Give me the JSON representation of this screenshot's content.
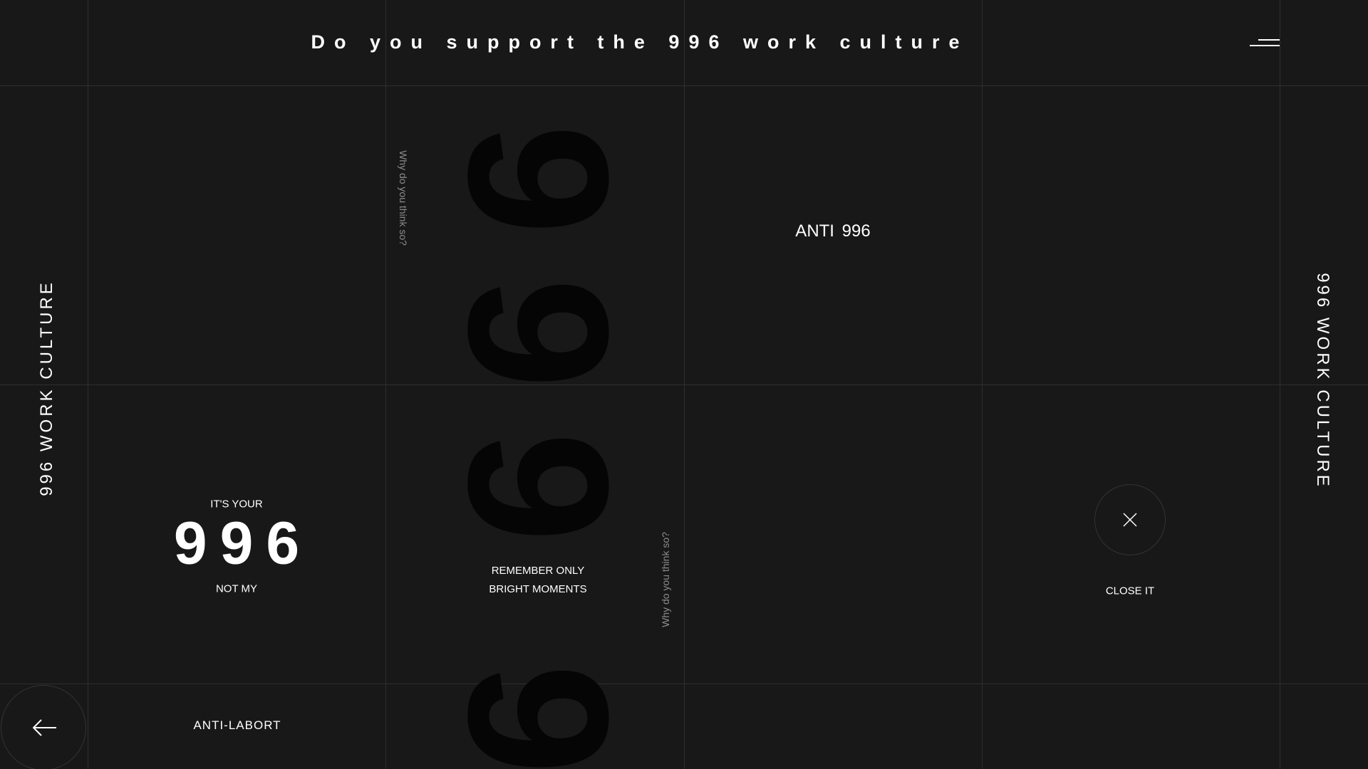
{
  "header": {
    "title": "Do you support the 996 work culture",
    "menu_icon": "menu-icon"
  },
  "sides": {
    "left_label": "996 WORK CULTURE",
    "right_label": "996 WORK CULTURE"
  },
  "big_digits": [
    "9",
    "9",
    "9",
    "9"
  ],
  "questions": {
    "upper": "Why do you think so?",
    "lower": "Why do you think so?"
  },
  "anti": {
    "label": "ANTI  996"
  },
  "promo": {
    "top": "IT'S YOUR",
    "number": "996",
    "bottom": "NOT MY"
  },
  "remember": {
    "line1": "REMEMBER ONLY",
    "line2": "BRIGHT MOMENTS"
  },
  "close": {
    "label": "CLOSE IT",
    "icon": "close-icon"
  },
  "footer": {
    "back_icon": "arrow-left-icon",
    "link": "ANTI-LABORT"
  },
  "colors": {
    "background": "#181818",
    "grid_line": "#2e2e2e",
    "text": "#ffffff",
    "muted_text": "#8c8c8c",
    "big_digit": "#050505"
  }
}
